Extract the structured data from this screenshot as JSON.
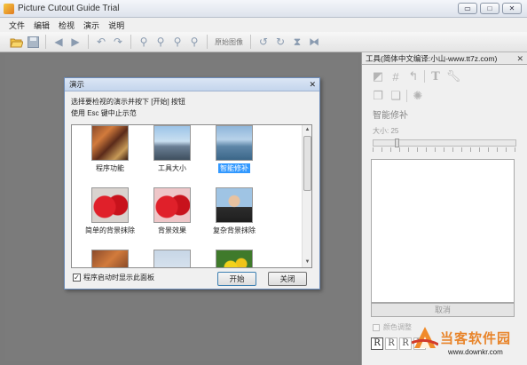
{
  "window": {
    "title": "Picture Cutout Guide Trial",
    "controls": [
      "▭",
      "□",
      "✕"
    ]
  },
  "menu": [
    "文件",
    "编辑",
    "检视",
    "演示",
    "说明"
  ],
  "toolbar": {
    "original_label": "原始图像"
  },
  "panel": {
    "title": "工具(简体中文编译:小山-www.tt7z.com)",
    "close": "✕",
    "section": "智能修补",
    "size_label": "大小: 25",
    "cancel": "取消",
    "color_adjust": "颜色调整",
    "bottom_icons": [
      "R",
      "R",
      "R",
      "R"
    ]
  },
  "dialog": {
    "title": "演示",
    "close": "✕",
    "line1": "选择要检视的演示并按下 [开始] 按钮",
    "line2": "使用 Esc 键中止示范",
    "items": [
      {
        "label": "程序功能",
        "selected": false
      },
      {
        "label": "工具大小",
        "selected": false
      },
      {
        "label": "智能修补",
        "selected": true
      },
      {
        "label": "简单的背景抹除",
        "selected": false
      },
      {
        "label": "背景效果",
        "selected": false
      },
      {
        "label": "复杂背景抹除",
        "selected": false
      }
    ],
    "checkbox_label": "程序启动时显示此面板",
    "checkbox_checked": true,
    "start_button": "开始",
    "close_button": "关闭"
  },
  "watermark": {
    "name": "当客软件园",
    "url": "www.downkr.com"
  }
}
